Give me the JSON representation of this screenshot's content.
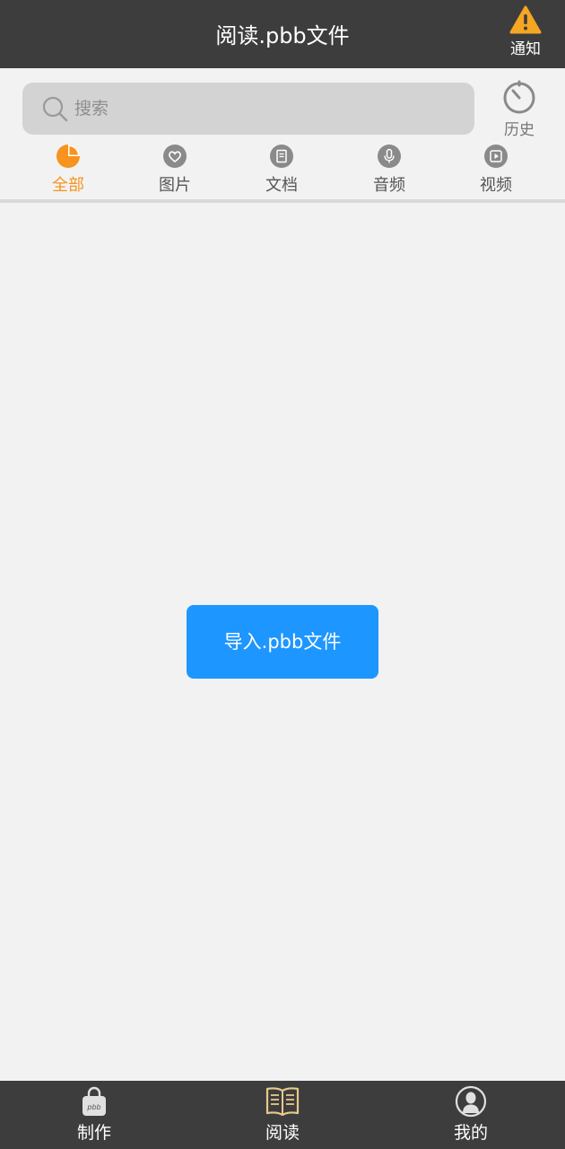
{
  "header": {
    "title": "阅读.pbb文件",
    "notify_label": "通知"
  },
  "search": {
    "placeholder": "搜索",
    "history_label": "历史"
  },
  "tabs": [
    {
      "label": "全部",
      "icon": "pie-chart-icon",
      "active": true
    },
    {
      "label": "图片",
      "icon": "heart-icon",
      "active": false
    },
    {
      "label": "文档",
      "icon": "document-icon",
      "active": false
    },
    {
      "label": "音频",
      "icon": "microphone-icon",
      "active": false
    },
    {
      "label": "视频",
      "icon": "play-icon",
      "active": false
    }
  ],
  "main": {
    "import_label": "导入.pbb文件"
  },
  "bottom_nav": [
    {
      "label": "制作",
      "icon": "pbb-bag-icon",
      "active": false
    },
    {
      "label": "阅读",
      "icon": "open-book-icon",
      "active": true
    },
    {
      "label": "我的",
      "icon": "user-icon",
      "active": false
    }
  ],
  "colors": {
    "header_bg": "#3d3d3d",
    "accent_orange": "#f7931e",
    "button_blue": "#1e96ff",
    "active_nav": "#e8c98a",
    "warning_yellow": "#f5a623"
  }
}
